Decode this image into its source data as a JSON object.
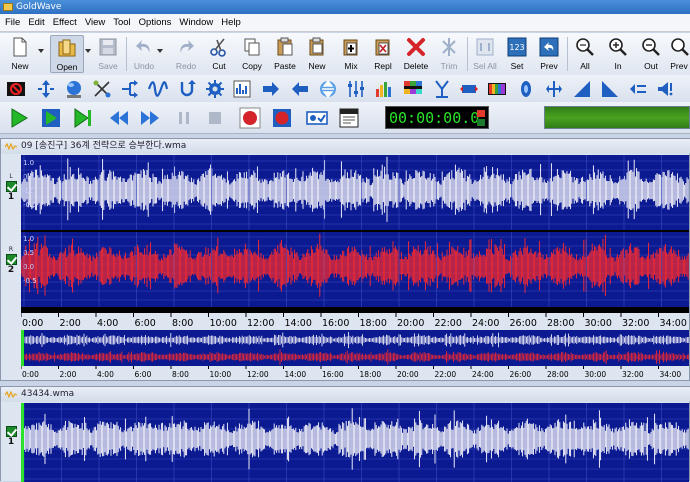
{
  "app": {
    "title": "GoldWave"
  },
  "menu": [
    "File",
    "Edit",
    "Effect",
    "View",
    "Tool",
    "Options",
    "Window",
    "Help"
  ],
  "toolbar": {
    "buttons": [
      {
        "label": "New",
        "icon": "new-file-icon",
        "enabled": true
      },
      {
        "label": "Open",
        "icon": "open-folder-icon",
        "enabled": true
      },
      {
        "label": "Save",
        "icon": "save-disk-icon",
        "enabled": false
      },
      {
        "label": "Undo",
        "icon": "undo-icon",
        "enabled": false
      },
      {
        "label": "Redo",
        "icon": "redo-icon",
        "enabled": false
      },
      {
        "label": "Cut",
        "icon": "scissors-icon",
        "enabled": true
      },
      {
        "label": "Copy",
        "icon": "copy-icon",
        "enabled": true
      },
      {
        "label": "Paste",
        "icon": "paste-icon",
        "enabled": true
      },
      {
        "label": "New",
        "icon": "paste-new-icon",
        "enabled": true
      },
      {
        "label": "Mix",
        "icon": "mix-icon",
        "enabled": true
      },
      {
        "label": "Repl",
        "icon": "replace-icon",
        "enabled": true
      },
      {
        "label": "Delete",
        "icon": "delete-x-icon",
        "enabled": true
      },
      {
        "label": "Trim",
        "icon": "trim-icon",
        "enabled": false
      },
      {
        "label": "Sel All",
        "icon": "select-all-icon",
        "enabled": false
      },
      {
        "label": "Set",
        "icon": "set-selection-icon",
        "enabled": true
      },
      {
        "label": "Prev",
        "icon": "previous-selection-icon",
        "enabled": true
      },
      {
        "label": "All",
        "icon": "zoom-all-icon",
        "enabled": true
      },
      {
        "label": "In",
        "icon": "zoom-in-icon",
        "enabled": true
      },
      {
        "label": "Out",
        "icon": "zoom-out-icon",
        "enabled": true
      },
      {
        "label": "Prev",
        "icon": "zoom-previous-icon",
        "enabled": true
      }
    ]
  },
  "transport": {
    "time": "00:00:00.0"
  },
  "windows": [
    {
      "title": "09 [송진구] 36계 전략으로 승부한다.wma",
      "channels": [
        {
          "letter": "L",
          "number": "1",
          "color": "#ffffff"
        },
        {
          "letter": "R",
          "number": "2",
          "color": "#ff2a2a"
        }
      ],
      "yticks": [
        "1.0",
        "0.5",
        "0.0",
        "-0.5"
      ],
      "timeline": [
        "0:00",
        "2:00",
        "4:00",
        "6:00",
        "8:00",
        "10:00",
        "12:00",
        "14:00",
        "16:00",
        "18:00",
        "20:00",
        "22:00",
        "24:00",
        "26:00",
        "28:00",
        "30:00",
        "32:00",
        "34:00"
      ],
      "overview_timeline": [
        "0:00",
        "2:00",
        "4:00",
        "6:00",
        "8:00",
        "10:00",
        "12:00",
        "14:00",
        "16:00",
        "18:00",
        "20:00",
        "22:00",
        "24:00",
        "26:00",
        "28:00",
        "30:00",
        "32:00",
        "34:00"
      ]
    },
    {
      "title": "43434.wma",
      "channels": [
        {
          "letter": "",
          "number": "1",
          "color": "#ffffff"
        }
      ]
    }
  ],
  "colors": {
    "wave_bg": "#0c1a92",
    "grid": "#3a4bc0",
    "left_wave": "#ffffff",
    "right_wave": "#ff2a2a",
    "time_digits": "#29e229"
  }
}
